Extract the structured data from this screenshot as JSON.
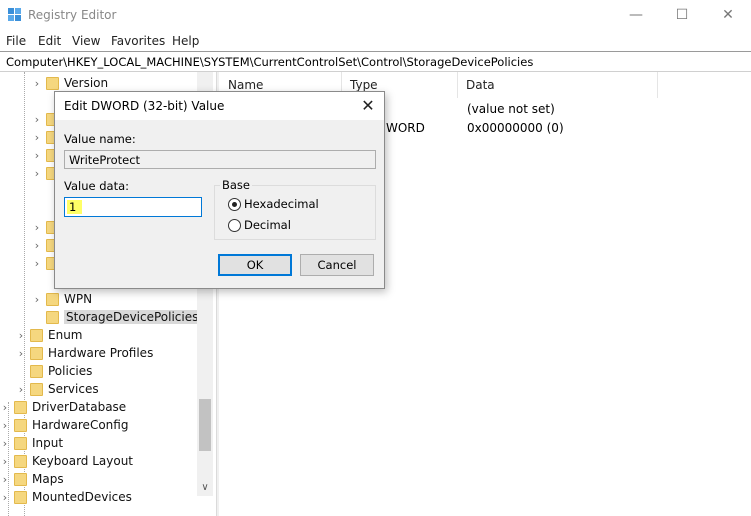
{
  "window": {
    "title": "Registry Editor"
  },
  "menu": [
    "File",
    "Edit",
    "View",
    "Favorites",
    "Help"
  ],
  "address": "Computer\\HKEY_LOCAL_MACHINE\\SYSTEM\\CurrentControlSet\\Control\\StorageDevicePolicies",
  "tree": {
    "version": "Version",
    "wpn": "WPN",
    "storage": "StorageDevicePolicies",
    "enum": "Enum",
    "hardware_profiles": "Hardware Profiles",
    "policies": "Policies",
    "services": "Services",
    "driver_database": "DriverDatabase",
    "hardware_config": "HardwareConfig",
    "input": "Input",
    "keyboard_layout": "Keyboard Layout",
    "maps": "Maps",
    "mounted_devices": "MountedDevices"
  },
  "list": {
    "columns": {
      "name": "Name",
      "type": "Type",
      "data": "Data"
    },
    "rows": [
      {
        "type": "",
        "data": "(value not set)"
      },
      {
        "type": "WORD",
        "data": "0x00000000 (0)"
      }
    ]
  },
  "dialog": {
    "title": "Edit DWORD (32-bit) Value",
    "value_name_label": "Value name:",
    "value_name": "WriteProtect",
    "value_data_label": "Value data:",
    "value_data": "1",
    "base_label": "Base",
    "hex_label": "Hexadecimal",
    "dec_label": "Decimal",
    "selected_base": "Hexadecimal",
    "ok": "OK",
    "cancel": "Cancel"
  },
  "colors": {
    "accent": "#0078d7",
    "folder": "#f5d77f",
    "highlight": "#ffff66"
  }
}
